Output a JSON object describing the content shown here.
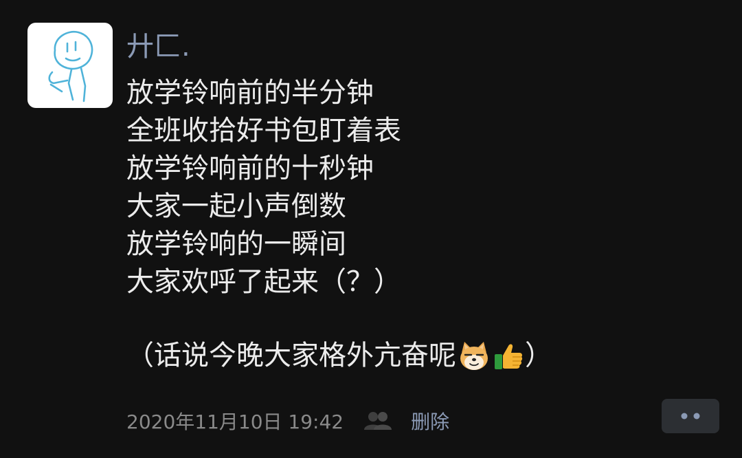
{
  "post": {
    "username": "廾匚.",
    "lines": [
      "放学铃响前的半分钟",
      "全班收拾好书包盯着表",
      "放学铃响前的十秒钟",
      "大家一起小声倒数",
      "放学铃响的一瞬间",
      "大家欢呼了起来（？）"
    ],
    "tail_text": "（话说今晚大家格外亢奋呢",
    "tail_close": "）",
    "emojis": [
      "doge-emoji",
      "thumbs-up-emoji"
    ]
  },
  "footer": {
    "timestamp": "2020年11月10日 19:42",
    "visibility_icon": "friends-icon",
    "delete_label": "删除"
  },
  "actions": {
    "more_icon": "two-dots-icon"
  },
  "colors": {
    "background": "#111111",
    "text": "#ececec",
    "link": "#8b9ab5",
    "meta": "#8a8a8a",
    "more_button_bg": "#2c2f33"
  }
}
